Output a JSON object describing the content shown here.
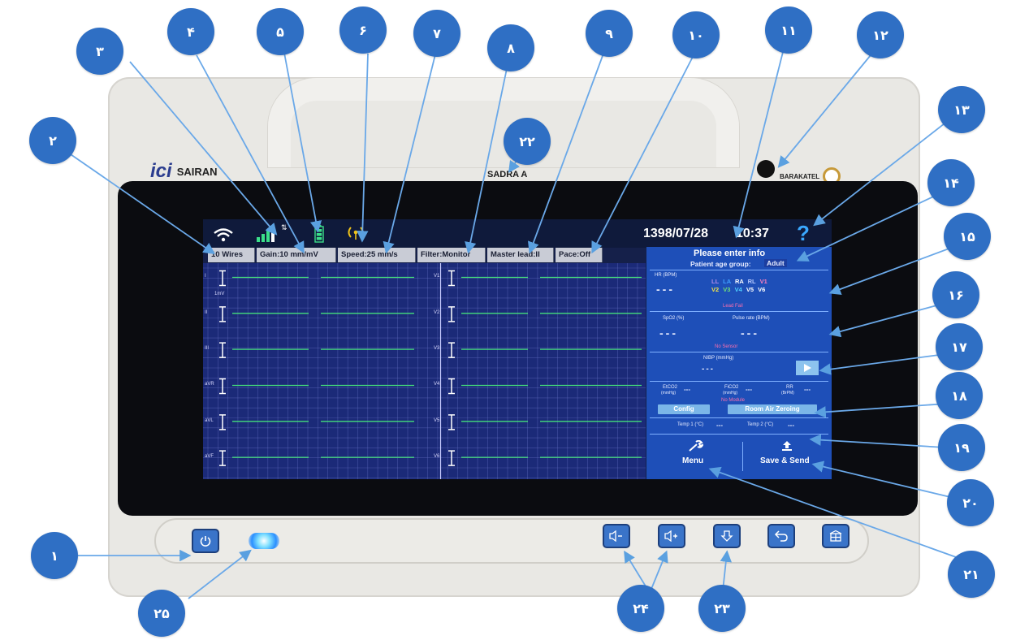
{
  "device": {
    "brand_logo": "ici",
    "brand_name": "SAIRAN",
    "model": "SADRA A",
    "partner_logo_text": "BARAKATEL"
  },
  "status_bar": {
    "date": "1398/07/28",
    "time": "10:37",
    "help_symbol": "?",
    "icons": [
      "wifi-icon",
      "signal-icon",
      "usb-transfer-icon",
      "battery-icon",
      "wireless-broadcast-icon"
    ]
  },
  "info_tabs": [
    "10 Wires",
    "Gain:10 mm/mV",
    "Speed:25 mm/s",
    "Filter:Monitor",
    "Master lead:II",
    "Pace:Off"
  ],
  "ecg": {
    "left_leads": [
      "I",
      "II",
      "III",
      "aVR",
      "aVL",
      "aVF"
    ],
    "right_leads": [
      "V1",
      "V2",
      "V3",
      "V4",
      "V5",
      "V6"
    ],
    "scale_label": "1mV"
  },
  "panel": {
    "header": "Please enter info",
    "age_group_label": "Patient age group:",
    "age_group_value": "Adult",
    "hr_label": "HR (BPM)",
    "hr_value": "---",
    "electrodes_row1": [
      "LL",
      "LA",
      "RA",
      "RL",
      "V1"
    ],
    "electrodes_row2": [
      "V2",
      "V3",
      "V4",
      "V5",
      "V6"
    ],
    "lead_fail": "Lead Fail",
    "spo2_label": "SpO2 (%)",
    "spo2_value": "---",
    "pulse_label": "Pulse rate (BPM)",
    "pulse_value": "---",
    "no_sensor": "No Sensor",
    "nibp_label": "NIBP (mmHg)",
    "nibp_value": "---",
    "etco2_label": "EtCO2",
    "etco2_unit": "(mmHg)",
    "etco2_value": "---",
    "fico2_label": "FiCO2",
    "fico2_unit": "(mmHg)",
    "fico2_value": "---",
    "rr_label": "RR",
    "rr_unit": "(BrPM)",
    "rr_value": "---",
    "no_module": "No Module",
    "config_button": "Config",
    "zeroing_button": "Room Air Zeroing",
    "temp1_label": "Temp 1 (°C)",
    "temp1_value": "---",
    "temp2_label": "Temp 2 (°C)",
    "temp2_value": "---",
    "menu_button": "Menu",
    "save_send_button": "Save & Send"
  },
  "hardware_buttons": [
    "power-icon",
    "volume-down-icon",
    "volume-up-icon",
    "arrow-down-icon",
    "back-icon",
    "home-icon"
  ],
  "callouts": [
    "۱",
    "۲",
    "۳",
    "۴",
    "۵",
    "۶",
    "۷",
    "۸",
    "۹",
    "۱۰",
    "۱۱",
    "۱۲",
    "۱۳",
    "۱۴",
    "۱۵",
    "۱۶",
    "۱۷",
    "۱۸",
    "۱۹",
    "۲۰",
    "۲۱",
    "۲۲",
    "۲۳",
    "۲۴",
    "۲۵"
  ],
  "colors": {
    "callout": "#2f6fc4",
    "screen_bg": "#1b2a78",
    "panel_bg": "#1e4fb8",
    "trace": "#44e07a",
    "help": "#3aa8ff"
  }
}
